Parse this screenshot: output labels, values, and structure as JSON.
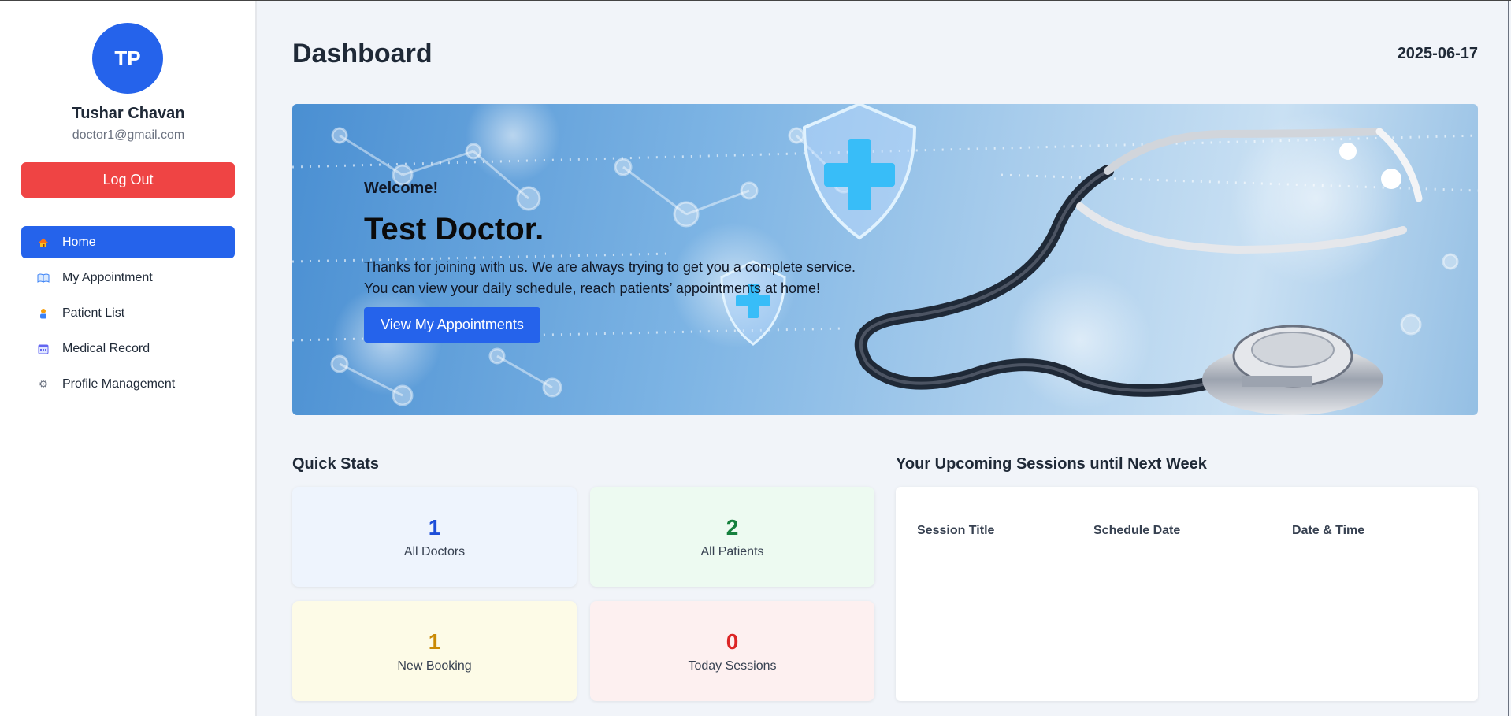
{
  "user": {
    "initials": "TP",
    "name": "Tushar Chavan",
    "email": "doctor1@gmail.com"
  },
  "sidebar": {
    "logout_label": "Log Out",
    "items": [
      {
        "label": "Home",
        "icon": "house-icon",
        "active": true
      },
      {
        "label": "My Appointment",
        "icon": "book-icon",
        "active": false
      },
      {
        "label": "Patient List",
        "icon": "person-icon",
        "active": false
      },
      {
        "label": "Medical Record",
        "icon": "calendar-icon",
        "active": false
      },
      {
        "label": "Profile Management",
        "icon": "gear-icon",
        "active": false
      }
    ]
  },
  "header": {
    "title": "Dashboard",
    "date": "2025-06-17"
  },
  "hero": {
    "welcome": "Welcome!",
    "name": "Test Doctor.",
    "line1": "Thanks for joining with us. We are always trying to get you a complete service.",
    "line2": "You can view your daily schedule, reach patients’ appointments at home!",
    "button_label": "View My Appointments"
  },
  "quick_stats": {
    "title": "Quick Stats",
    "cards": [
      {
        "value": "1",
        "label": "All Doctors",
        "color": "#1d4ed8",
        "bg": "#eef4fd"
      },
      {
        "value": "2",
        "label": "All Patients",
        "color": "#15803d",
        "bg": "#edfaf1"
      },
      {
        "value": "1",
        "label": "New Booking",
        "color": "#ca8a04",
        "bg": "#fdfbe7"
      },
      {
        "value": "0",
        "label": "Today Sessions",
        "color": "#dc2626",
        "bg": "#fdf0f0"
      }
    ]
  },
  "sessions": {
    "title": "Your Upcoming Sessions until Next Week",
    "columns": [
      "Session Title",
      "Schedule Date",
      "Date & Time"
    ]
  },
  "colors": {
    "accent": "#2563eb",
    "danger": "#ef4444"
  }
}
